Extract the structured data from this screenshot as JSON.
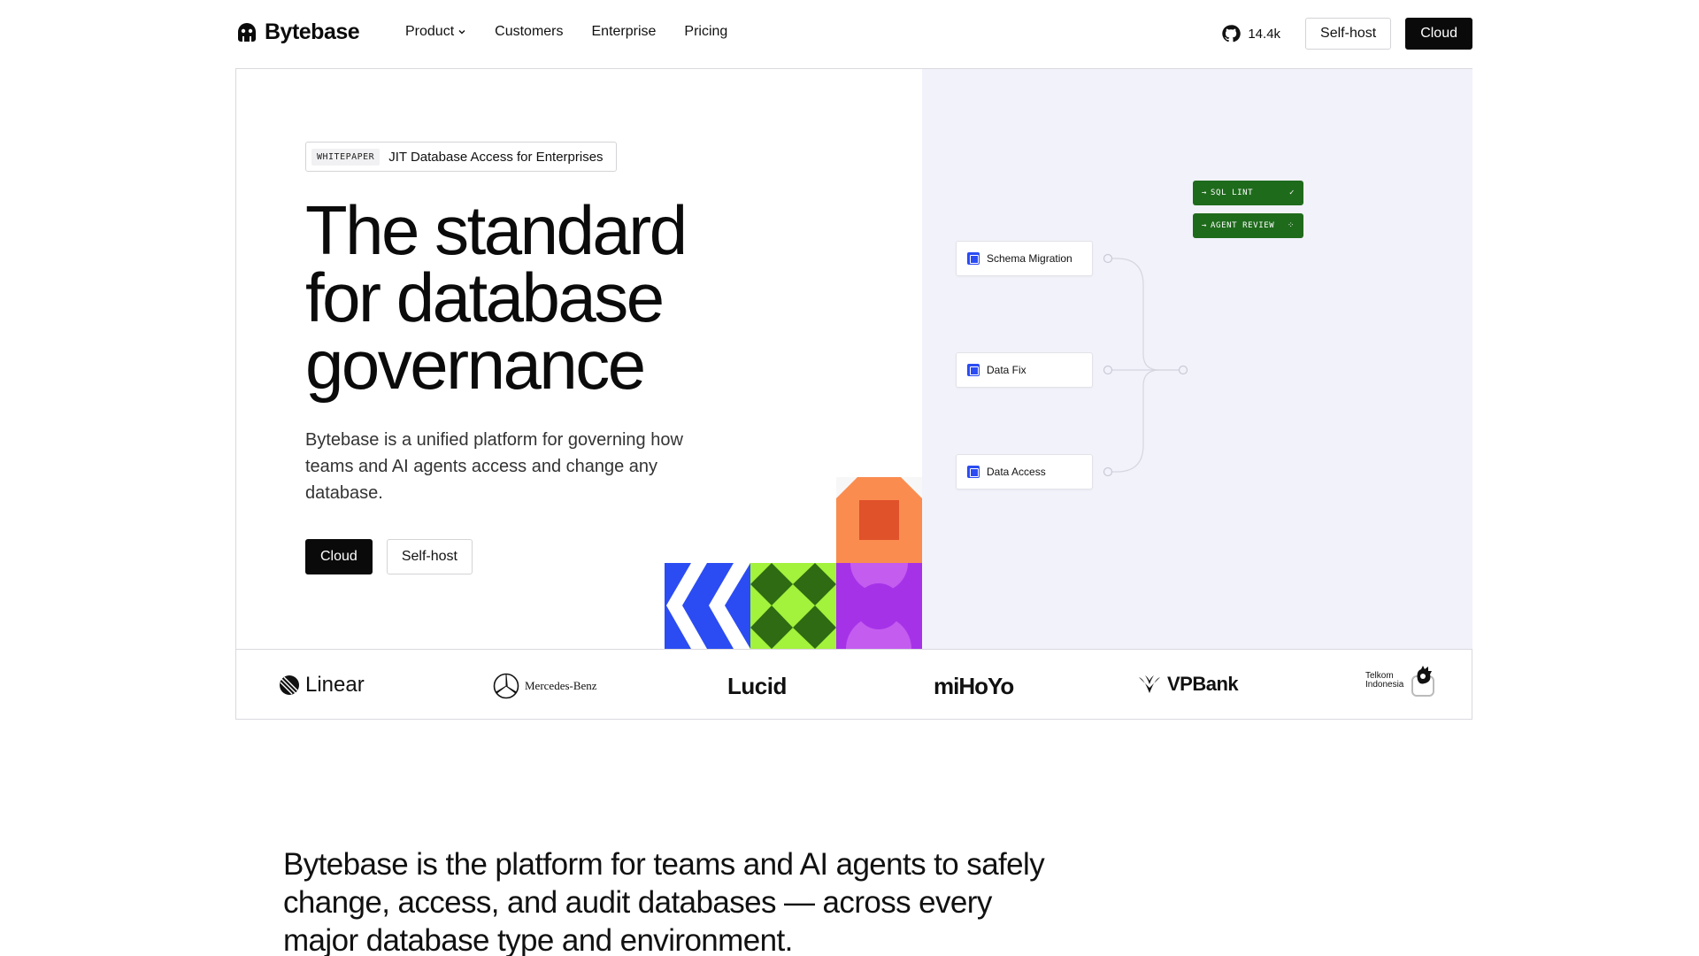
{
  "nav": {
    "logo_text": "Bytebase",
    "links": [
      {
        "label": "Product",
        "has_dropdown": true
      },
      {
        "label": "Customers"
      },
      {
        "label": "Enterprise"
      },
      {
        "label": "Pricing"
      }
    ],
    "github_stars": "14.4k",
    "self_host_label": "Self-host",
    "cloud_label": "Cloud"
  },
  "hero": {
    "badge_tag": "WHITEPAPER",
    "badge_text": "JIT Database Access for Enterprises",
    "headline": "The standard for database governance",
    "subheadline": "Bytebase is a unified platform for governing how teams and AI agents access and change any database.",
    "cta_primary": "Cloud",
    "cta_secondary": "Self-host"
  },
  "flow": {
    "nodes": [
      "Schema Migration",
      "Data Fix",
      "Data Access"
    ],
    "checks": [
      {
        "label": "SQL LINT",
        "status": "✓"
      },
      {
        "label": "AGENT REVIEW",
        "status": "⁘"
      }
    ]
  },
  "customers": [
    {
      "name": "Linear"
    },
    {
      "name": "Mercedes-Benz"
    },
    {
      "name": "Lucid"
    },
    {
      "name": "miHoYo"
    },
    {
      "name": "VPBank"
    },
    {
      "name": "Telkom Indonesia",
      "line1": "Telkom",
      "line2": "Indonesia"
    }
  ],
  "colors": {
    "accent_blue": "#2b4cf2",
    "accent_green": "#1f6b1c",
    "hero_panel_bg": "#f2f2fb",
    "dark": "#0a0a0a"
  },
  "statement": "Bytebase is the platform for teams and AI agents to safely change, access, and audit databases — across every major database type and environment."
}
